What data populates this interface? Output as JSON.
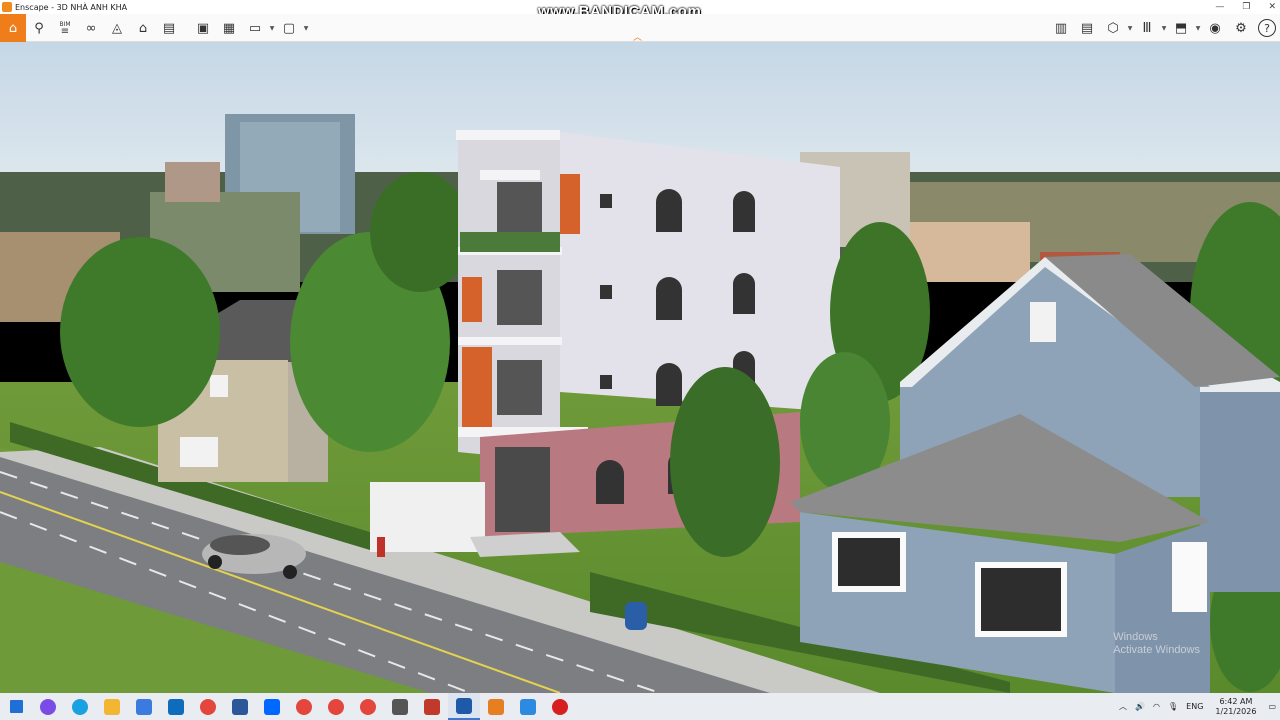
{
  "window": {
    "title": "Enscape - 3D NHÀ ANH KHA",
    "recording_watermark": "www.BANDICAM.com"
  },
  "toolbar": {
    "left_icons": [
      "home-icon",
      "location-pin-icon",
      "bim-icon",
      "binoculars-icon",
      "orbit-icon",
      "building-icon",
      "clapboard-icon",
      "screenshot-icon",
      "batch-render-icon",
      "export-video-icon",
      "export-panorama-icon"
    ],
    "bim_label": "BIM",
    "right_icons": [
      "map-icon",
      "panorama-icon",
      "asset-library-icon",
      "material-icon",
      "upload-icon",
      "visual-settings-icon",
      "settings-icon",
      "help-icon"
    ],
    "help_label": "?"
  },
  "scene": {
    "description_marks": "render viewport"
  },
  "windows_activation": {
    "line1": "Windows",
    "line2": "Activate Windows"
  },
  "taskbar": {
    "apps": [
      {
        "name": "start-icon",
        "color": "#1f6fd6"
      },
      {
        "name": "copilot-icon",
        "color": "#7b4be6"
      },
      {
        "name": "edge-icon",
        "color": "#1aa1e0"
      },
      {
        "name": "file-explorer-icon",
        "color": "#f2b632"
      },
      {
        "name": "store-icon",
        "color": "#3b7be0"
      },
      {
        "name": "outlook-icon",
        "color": "#0f6cbd"
      },
      {
        "name": "chrome-icon",
        "color": "#e3463c"
      },
      {
        "name": "word-icon",
        "color": "#2b579a"
      },
      {
        "name": "zalo-icon",
        "color": "#0068ff"
      },
      {
        "name": "chrome-icon",
        "color": "#e3463c"
      },
      {
        "name": "chrome-icon",
        "color": "#e3463c"
      },
      {
        "name": "chrome-icon",
        "color": "#e3463c"
      },
      {
        "name": "calculator-icon",
        "color": "#555555"
      },
      {
        "name": "sketchup-icon",
        "color": "#c0392b"
      },
      {
        "name": "revit-icon",
        "color": "#1e5aa8"
      },
      {
        "name": "enscape-icon",
        "color": "#e67e22"
      },
      {
        "name": "photos-icon",
        "color": "#2d8ae0"
      },
      {
        "name": "bandicam-icon",
        "color": "#d62020"
      }
    ],
    "tray": {
      "language": "ENG",
      "time": "6:42 AM",
      "date": "1/21/2026"
    }
  }
}
